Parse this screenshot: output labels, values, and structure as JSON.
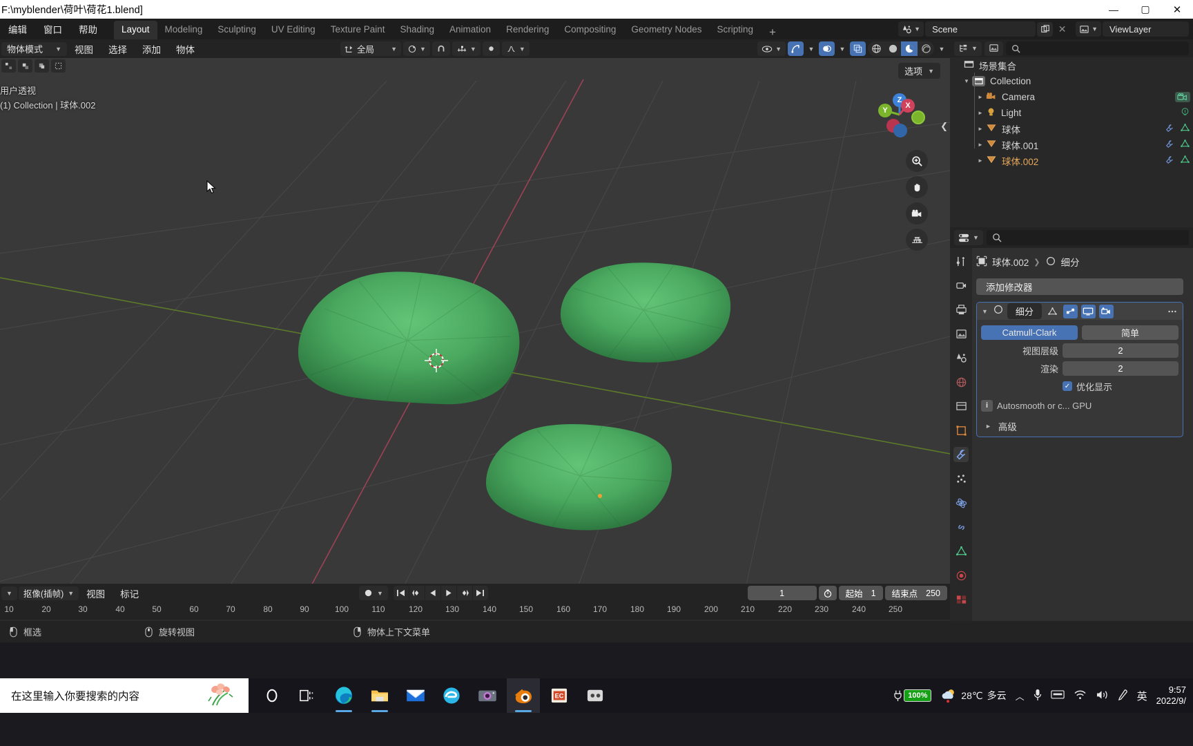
{
  "window": {
    "title": "F:\\myblender\\荷叶\\荷花1.blend]",
    "minimize": "—",
    "maximize": "▢",
    "close": "✕"
  },
  "topbar": {
    "menus": [
      "编辑",
      "窗口",
      "帮助"
    ],
    "tabs": [
      {
        "label": "Layout",
        "active": true
      },
      {
        "label": "Modeling",
        "active": false
      },
      {
        "label": "Sculpting",
        "active": false
      },
      {
        "label": "UV Editing",
        "active": false
      },
      {
        "label": "Texture Paint",
        "active": false
      },
      {
        "label": "Shading",
        "active": false
      },
      {
        "label": "Animation",
        "active": false
      },
      {
        "label": "Rendering",
        "active": false
      },
      {
        "label": "Compositing",
        "active": false
      },
      {
        "label": "Geometry Nodes",
        "active": false
      },
      {
        "label": "Scripting",
        "active": false
      }
    ],
    "add_tab": "+",
    "scene_name": "Scene",
    "viewlayer_name": "ViewLayer",
    "scene_icon": "scene-icon",
    "viewlayer_icon": "viewlayer-icon",
    "copy_icon": "duplicate-icon",
    "delete_icon": "close-icon"
  },
  "viewport": {
    "mode": "物体模式",
    "menus": [
      "视图",
      "选择",
      "添加",
      "物体"
    ],
    "transform_orientation": "全局",
    "options_label": "选项",
    "overlay_line1": "用户透视",
    "overlay_line2": "(1) Collection | 球体.002",
    "gizmo_axes": [
      {
        "label": "Z",
        "color": "#3b82d8"
      },
      {
        "label": "X",
        "color": "#d0415c"
      },
      {
        "label": "Y",
        "color": "#7ab52c"
      }
    ],
    "tools": [
      "zoom-icon",
      "hand-icon",
      "camera-icon",
      "grid-icon"
    ],
    "shading_modes": [
      "wireframe-icon",
      "solid-icon",
      "material-preview-icon",
      "rendered-icon"
    ],
    "active_shading": "material-preview-icon",
    "leaf_color_light": "#5dbd6e",
    "leaf_color_dark": "#2f7a42",
    "background": "#393939"
  },
  "timeline": {
    "editor_type": "抠像(插帧)",
    "menus": [
      "视图",
      "标记"
    ],
    "playback_buttons": [
      "jump-start-icon",
      "prev-keyframe-icon",
      "play-reverse-icon",
      "play-icon",
      "next-keyframe-icon",
      "jump-end-icon"
    ],
    "current_frame": "1",
    "start_label": "起始",
    "start_value": "1",
    "end_label": "结束点",
    "end_value": "250",
    "ticks": [
      "10",
      "20",
      "30",
      "40",
      "50",
      "60",
      "70",
      "80",
      "90",
      "100",
      "110",
      "120",
      "130",
      "140",
      "150",
      "160",
      "170",
      "180",
      "190",
      "200",
      "210",
      "220",
      "230",
      "240",
      "250"
    ]
  },
  "outliner": {
    "display_mode_icon": "outliner-icon",
    "filter_icon": "filter-icon",
    "search_icon": "search-icon",
    "rows": [
      {
        "label": "场景集合",
        "depth": 0,
        "icon": "collection-icon",
        "expand": "",
        "extra": []
      },
      {
        "label": "Collection",
        "depth": 1,
        "icon": "collection-icon",
        "expand": "▼",
        "extra": []
      },
      {
        "label": "Camera",
        "depth": 2,
        "icon": "camera-data-icon",
        "expand": "►",
        "extra": [
          "camera-object-icon"
        ]
      },
      {
        "label": "Light",
        "depth": 2,
        "icon": "light-data-icon",
        "expand": "►",
        "extra": [
          "light-object-icon"
        ]
      },
      {
        "label": "球体",
        "depth": 2,
        "icon": "mesh-icon",
        "expand": "►",
        "extra": [
          "modifier-icon",
          "mesh-data-icon"
        ]
      },
      {
        "label": "球体.001",
        "depth": 2,
        "icon": "mesh-icon",
        "expand": "►",
        "extra": [
          "modifier-icon",
          "mesh-data-icon"
        ]
      },
      {
        "label": "球体.002",
        "depth": 2,
        "icon": "mesh-icon",
        "expand": "►",
        "extra": [
          "modifier-icon",
          "mesh-data-icon"
        ]
      }
    ]
  },
  "properties": {
    "editor_icon": "properties-icon",
    "search_icon": "search-icon",
    "breadcrumb_object": "球体.002",
    "breadcrumb_sep": "❯",
    "breadcrumb_modifier": "细分",
    "add_modifier": "添加修改器",
    "tabs": [
      "tool-icon",
      "render-icon",
      "output-icon",
      "viewlayer-icon",
      "scene-icon",
      "world-icon",
      "collection-icon",
      "object-icon",
      "modifier-icon",
      "particles-icon",
      "physics-icon",
      "constraint-icon",
      "data-icon",
      "material-icon",
      "texture-icon"
    ],
    "active_tab": "modifier-icon",
    "modifier": {
      "expand_icon": "chevron-down-icon",
      "type_icon": "subsurf-icon",
      "name": "细分",
      "toggles": [
        "edit-mode-icon",
        "on-cage-icon",
        "realtime-icon",
        "render-icon"
      ],
      "toggles_on": [
        false,
        true,
        true,
        true
      ],
      "algorithm_active": "Catmull-Clark",
      "algorithm_other": "简单",
      "viewport_label": "视图层级",
      "viewport_value": "2",
      "render_label": "渲染",
      "render_value": "2",
      "optimal_display_label": "优化显示",
      "optimal_display_checked": true,
      "info_text": "Autosmooth or c... GPU",
      "advanced_label": "高级",
      "advanced_icon": "chevron-right-icon"
    }
  },
  "statusbar": {
    "items": [
      {
        "icon": "mouse-left-icon",
        "label": "框选"
      },
      {
        "icon": "mouse-middle-icon",
        "label": "旋转视图"
      },
      {
        "icon": "mouse-right-icon",
        "label": "物体上下文菜单"
      }
    ]
  },
  "taskbar": {
    "search_placeholder": "在这里输入你要搜索的内容",
    "search_icon": "flower-icon",
    "apps": [
      {
        "name": "cortana-icon",
        "active": false,
        "underline": false
      },
      {
        "name": "task-view-icon",
        "active": false,
        "underline": false
      },
      {
        "name": "edge-icon",
        "active": false,
        "underline": true
      },
      {
        "name": "file-explorer-icon",
        "active": false,
        "underline": true
      },
      {
        "name": "mail-icon",
        "active": false,
        "underline": false
      },
      {
        "name": "browser-icon",
        "active": false,
        "underline": false
      },
      {
        "name": "camera-app-icon",
        "active": false,
        "underline": false
      },
      {
        "name": "blender-icon",
        "active": true,
        "underline": true
      },
      {
        "name": "powerpoint-icon",
        "active": false,
        "underline": false
      },
      {
        "name": "app-icon",
        "active": false,
        "underline": false
      }
    ],
    "battery": "100%",
    "weather_temp": "28℃",
    "weather_desc": "多云",
    "ime": "英",
    "time": "9:57",
    "date": "2022/9/"
  }
}
